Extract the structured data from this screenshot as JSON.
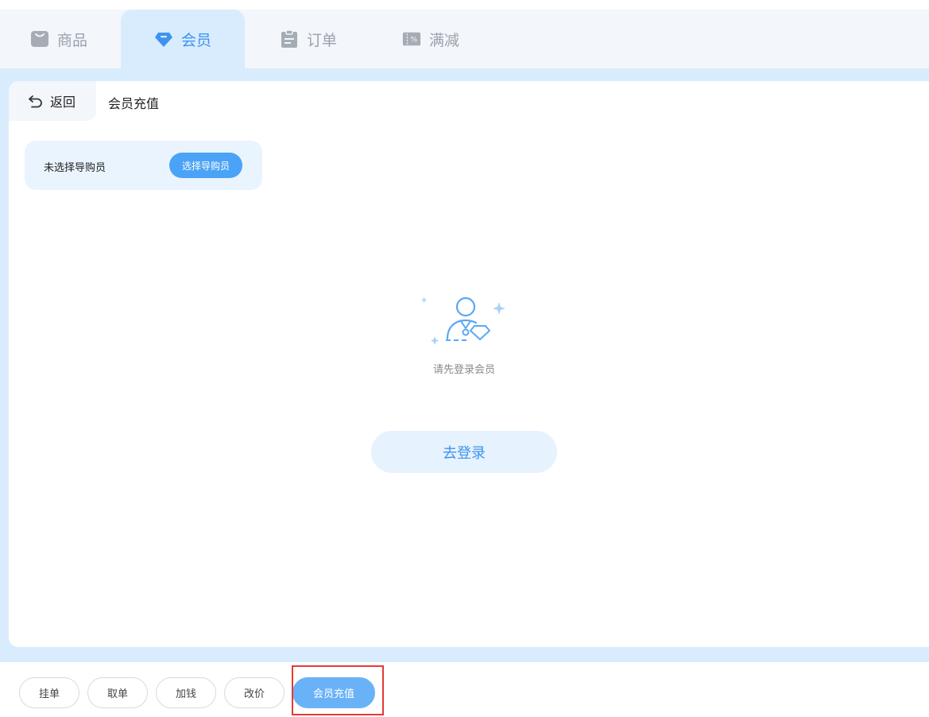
{
  "tabs": {
    "goods": "商品",
    "member": "会员",
    "order": "订单",
    "promotion": "满减"
  },
  "header": {
    "back_label": "返回",
    "title": "会员充值"
  },
  "guide": {
    "status_text": "未选择导购员",
    "select_button": "选择导购员"
  },
  "empty_state": {
    "message": "请先登录会员",
    "login_button": "去登录"
  },
  "bottom_actions": {
    "hold": "挂单",
    "fetch": "取单",
    "add_fee": "加钱",
    "change_price": "改价",
    "recharge": "会员充值"
  },
  "icons": {
    "goods": "shopping-bag-icon",
    "member": "diamond-icon",
    "order": "clipboard-icon",
    "promotion": "discount-ticket-icon",
    "back": "undo-arrow-icon",
    "empty": "member-avatar-illustration"
  },
  "colors": {
    "accent": "#3d93f0",
    "panel_bg": "#d9ecfd",
    "highlight": "#e53935"
  }
}
